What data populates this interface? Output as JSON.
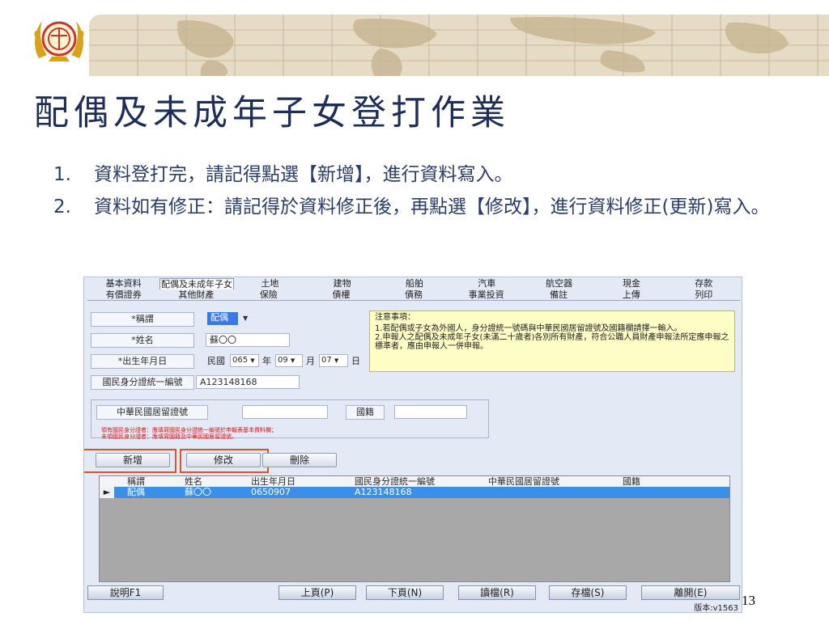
{
  "slide": {
    "title": "配偶及未成年子女登打作業",
    "bullets": [
      {
        "num": "1.",
        "text": "資料登打完，請記得點選【新增】，進行資料寫入。"
      },
      {
        "num": "2.",
        "text": "資料如有修正：請記得於資料修正後，再點選【修改】，進行資料修正(更新)寫入。"
      }
    ],
    "page_number": "13"
  },
  "app": {
    "tabs_row1": [
      "基本資料",
      "配偶及未成年子女",
      "土地",
      "建物",
      "船舶",
      "汽車",
      "航空器",
      "現金",
      "存款"
    ],
    "tabs_row2": [
      "有價證券",
      "其他財產",
      "保險",
      "債權",
      "債務",
      "事業投資",
      "備註",
      "上傳",
      "列印"
    ],
    "active_tab": "配偶及未成年子女",
    "form": {
      "relation_label": "*稱謂",
      "relation_value": "配偶",
      "name_label": "*姓名",
      "name_value": "蘇〇〇",
      "birth_label": "*出生年月日",
      "era_label": "民國",
      "birth_year": "065",
      "year_unit": "年",
      "birth_month": "09",
      "month_unit": "月",
      "birth_day": "07",
      "day_unit": "日",
      "id_label": "國民身分證統一編號",
      "id_value": "A123148168",
      "residence_label": "中華民國居留證號",
      "residence_value": "",
      "nationality_label": "國籍",
      "nationality_value": "",
      "hint_line1": "領有國民身分證者：應填寫國民身分證統一編號於申報表基本資料欄；",
      "hint_line2": "未領國民身分證者：應填寫國籍及中華民國居留證號。"
    },
    "notice": {
      "title": "注意事項：",
      "line1": "1.若配偶或子女為外國人，身分證統一號碼與中華民國居留證號及國籍欄請擇一輸入。",
      "line2": "2.申報人之配偶及未成年子女(未滿二十歲者)各別所有財產，符合公職人員財產申報法所定應申報之標準者，應由申報人一併申報。"
    },
    "actions": {
      "add": "新增",
      "edit": "修改",
      "delete": "刪除"
    },
    "grid": {
      "columns": [
        "稱謂",
        "姓名",
        "出生年月日",
        "國民身分證統一編號",
        "中華民國居留證號",
        "國籍"
      ],
      "rows": [
        {
          "marker": "►",
          "cells": [
            "配偶",
            "蘇〇〇",
            "0650907",
            "A123148168",
            "",
            ""
          ]
        }
      ]
    },
    "bottom": {
      "help": "說明F1",
      "prev": "上頁(P)",
      "next": "下頁(N)",
      "load": "讀檔(R)",
      "save": "存檔(S)",
      "exit": "離開(E)"
    },
    "version": "版本:v1563"
  },
  "colors": {
    "title_navy": "#1f2e58",
    "bullet_navy": "#2b3d6b",
    "highlight_orange": "#d9532b",
    "selection_blue": "#3d8ee6",
    "notice_yellow": "#fdfdc6",
    "map_parchment": "#e6dcc6"
  },
  "icons": {
    "emblem": "government-seal-icon",
    "row_marker": "row-pointer-icon",
    "dropdown": "dropdown-caret-icon"
  }
}
